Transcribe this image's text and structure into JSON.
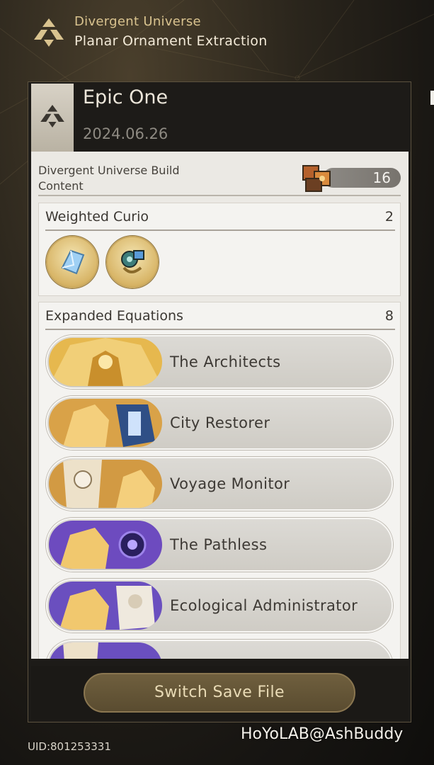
{
  "header": {
    "title": "Divergent Universe",
    "subtitle": "Planar Ornament Extraction",
    "logo_icon": "divergent-universe-emblem-icon"
  },
  "save_file": {
    "name": "Epic One",
    "date": "2024.06.26",
    "build_label": "Divergent Universe Build Content",
    "build_count": "16"
  },
  "weighted_curio": {
    "title": "Weighted Curio",
    "count": "2",
    "items": [
      {
        "icon": "crystal-shard-curio-icon"
      },
      {
        "icon": "mechanical-compass-curio-icon"
      }
    ]
  },
  "expanded_equations": {
    "title": "Expanded Equations",
    "count": "8",
    "items": [
      {
        "label": "The Architects",
        "theme": "gold"
      },
      {
        "label": "City Restorer",
        "theme": "gold"
      },
      {
        "label": "Voyage Monitor",
        "theme": "gold"
      },
      {
        "label": "The Pathless",
        "theme": "purple"
      },
      {
        "label": "Ecological Administrator",
        "theme": "purple"
      },
      {
        "label": "",
        "theme": "purple"
      }
    ]
  },
  "actions": {
    "switch_label": "Switch Save File"
  },
  "footer": {
    "uid": "UID:801253331",
    "watermark": "HoYoLAB@AshBuddy"
  },
  "colors": {
    "accent_gold": "#d9c38f",
    "panel_bg": "#ebe9e4",
    "row_bg": "#d4d1cb",
    "button_bg": "#5f5135",
    "purple_theme": "#7a58c9"
  }
}
